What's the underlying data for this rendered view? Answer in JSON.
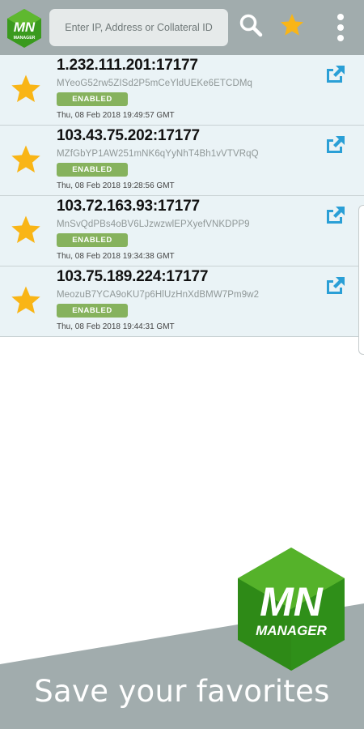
{
  "header": {
    "logo_text_top": "MN",
    "logo_text_bottom": "MANAGER",
    "search_placeholder": "Enter IP, Address or Collateral ID",
    "icons": {
      "search": "search-icon",
      "favorites": "star-icon",
      "menu": "more-vertical-icon"
    }
  },
  "colors": {
    "topbar": "#a1acad",
    "row_bg": "#eaf3f6",
    "badge": "#86b25d",
    "star": "#f9b516",
    "open_icon": "#2a9fd6",
    "logo_green": "#3a9a1e"
  },
  "masternodes": [
    {
      "address": "1.232.111.201:17177",
      "key": "MYeoG52rw5ZISd2P5mCeYldUEKe6ETCDMq",
      "status": "ENABLED",
      "time": "Thu, 08 Feb 2018 19:49:57 GMT",
      "favorite": true
    },
    {
      "address": "103.43.75.202:17177",
      "key": "MZfGbYP1AW251mNK6qYyNhT4Bh1vVTVRqQ",
      "status": "ENABLED",
      "time": "Thu, 08 Feb 2018 19:28:56 GMT",
      "favorite": true
    },
    {
      "address": "103.72.163.93:17177",
      "key": "MnSvQdPBs4oBV6LJzwzwlEPXyefVNKDPP9",
      "status": "ENABLED",
      "time": "Thu, 08 Feb 2018 19:34:38 GMT",
      "favorite": true
    },
    {
      "address": "103.75.189.224:17177",
      "key": "MeozuB7YCA9oKU7p6HlUzHnXdBMW7Pm9w2",
      "status": "ENABLED",
      "time": "Thu, 08 Feb 2018 19:44:31 GMT",
      "favorite": true
    }
  ],
  "promo": {
    "tagline": "Save your favorites",
    "logo_text_top": "MN",
    "logo_text_bottom": "MANAGER"
  }
}
